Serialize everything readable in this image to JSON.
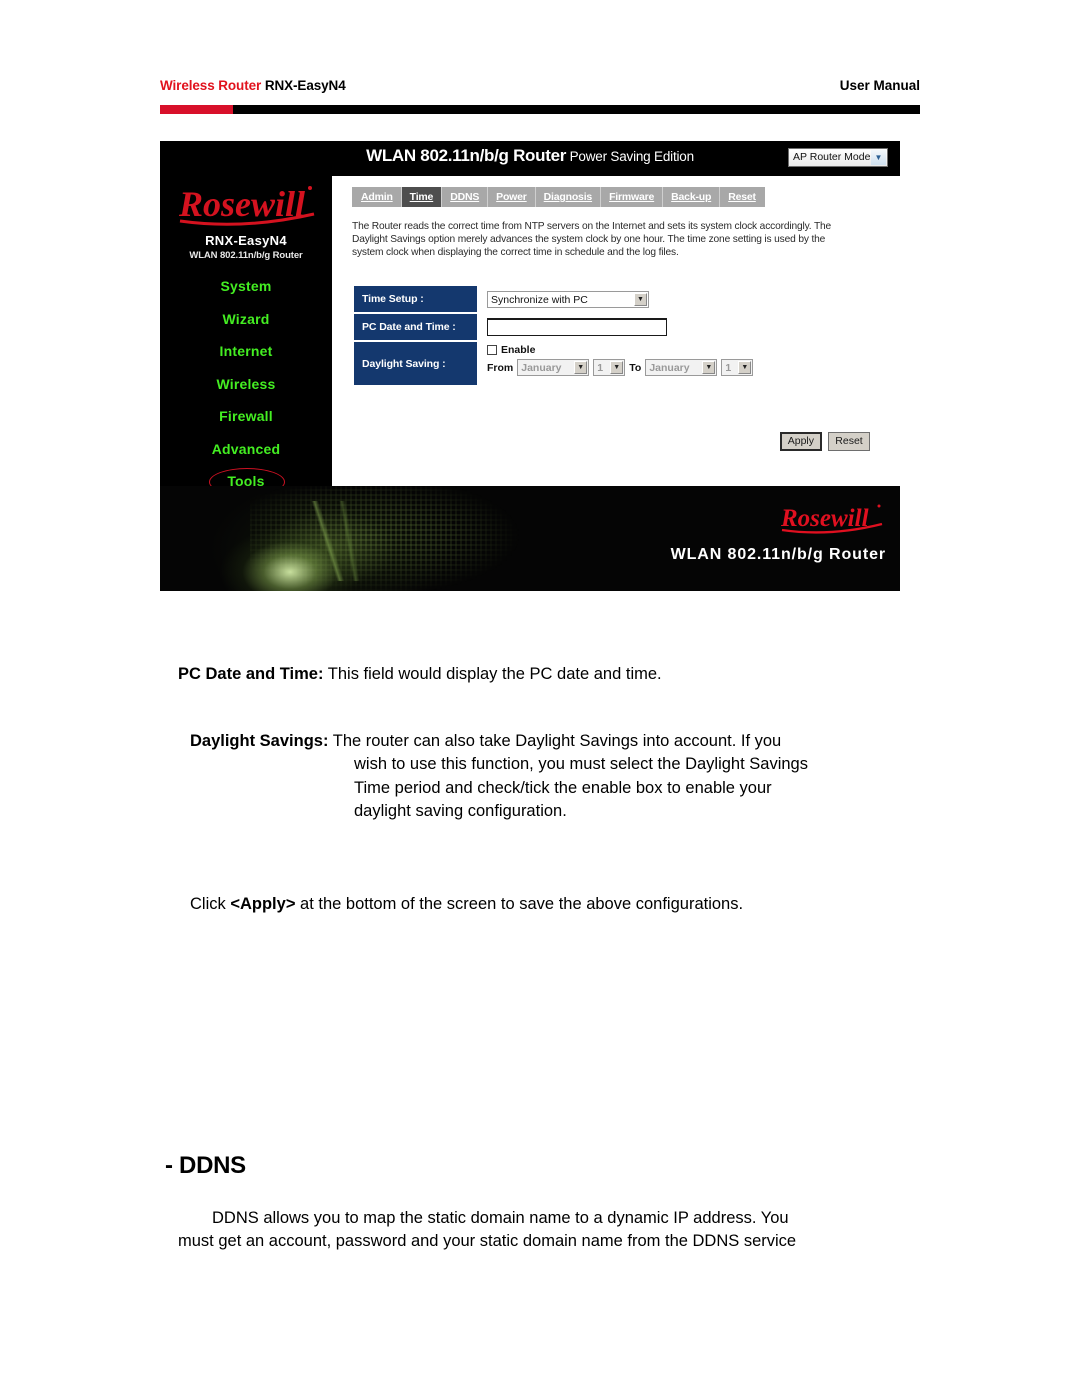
{
  "page_header": {
    "left_red": "Wireless Router",
    "left_black": " RNX-EasyN4",
    "right": "User Manual"
  },
  "router_ui": {
    "title_main": "WLAN 802.11n/b/g Router",
    "title_sub": " Power Saving Edition",
    "mode_select": {
      "value": "AP Router Mode",
      "icon": "chevron-down-icon"
    },
    "brand": "Rosewill",
    "nav": {
      "model": "RNX-EasyN4",
      "model_sub": "WLAN 802.11n/b/g Router",
      "items": [
        {
          "label": "System",
          "highlighted": false
        },
        {
          "label": "Wizard",
          "highlighted": false
        },
        {
          "label": "Internet",
          "highlighted": false
        },
        {
          "label": "Wireless",
          "highlighted": false
        },
        {
          "label": "Firewall",
          "highlighted": false
        },
        {
          "label": "Advanced",
          "highlighted": false
        },
        {
          "label": "Tools",
          "highlighted": true
        }
      ]
    },
    "tabs": [
      {
        "label": "Admin",
        "active": false
      },
      {
        "label": "Time",
        "active": true
      },
      {
        "label": "DDNS",
        "active": false
      },
      {
        "label": "Power",
        "active": false
      },
      {
        "label": "Diagnosis",
        "active": false
      },
      {
        "label": "Firmware",
        "active": false
      },
      {
        "label": "Back-up",
        "active": false
      },
      {
        "label": "Reset",
        "active": false
      }
    ],
    "description": "The Router reads the correct time from NTP servers on the Internet and sets its system clock accordingly. The Daylight Savings option merely advances the system clock by one hour. The time zone setting is used by the system clock when displaying the correct time in schedule and the log files.",
    "form": {
      "time_setup": {
        "label": "Time Setup :",
        "value": "Synchronize with PC"
      },
      "pc_date_time": {
        "label": "PC Date and Time :",
        "value": ""
      },
      "daylight_saving": {
        "label": "Daylight Saving :",
        "enable_label": "Enable",
        "enabled": false,
        "from_label": "From",
        "from_month": "January",
        "from_day": "1",
        "to_label": "To",
        "to_month": "January",
        "to_day": "1"
      }
    },
    "buttons": {
      "apply": "Apply",
      "reset": "Reset"
    },
    "banner": {
      "brand": "Rosewill",
      "text": "WLAN 802.11n/b/g Router"
    }
  },
  "body": {
    "pc_date_time_para": {
      "term": "PC Date and Time:",
      "text": " This field would display the PC date and time."
    },
    "daylight_savings_para": {
      "term": "Daylight Savings:",
      "line1": " The router can also take Daylight Savings into account. If you",
      "line2": "wish to use this function, you must select the Daylight Savings",
      "line3": "Time period and check/tick the enable box to enable your",
      "line4": "daylight saving configuration."
    },
    "apply_para": {
      "before": "Click ",
      "bold": "<Apply>",
      "after": " at the bottom of the screen to save the above configurations."
    },
    "ddns_heading": "- DDNS",
    "ddns_para": {
      "line1": "DDNS allows you to map the static domain name to a dynamic IP address. You",
      "line2": "must get an account, password and your static domain name from the DDNS service"
    }
  },
  "colors": {
    "brand_red": "#e1121d",
    "rule_red": "#d8102a",
    "nav_green": "#44ee22",
    "field_label_blue": "#14386e",
    "highlight_oval_red": "#cc1122"
  }
}
